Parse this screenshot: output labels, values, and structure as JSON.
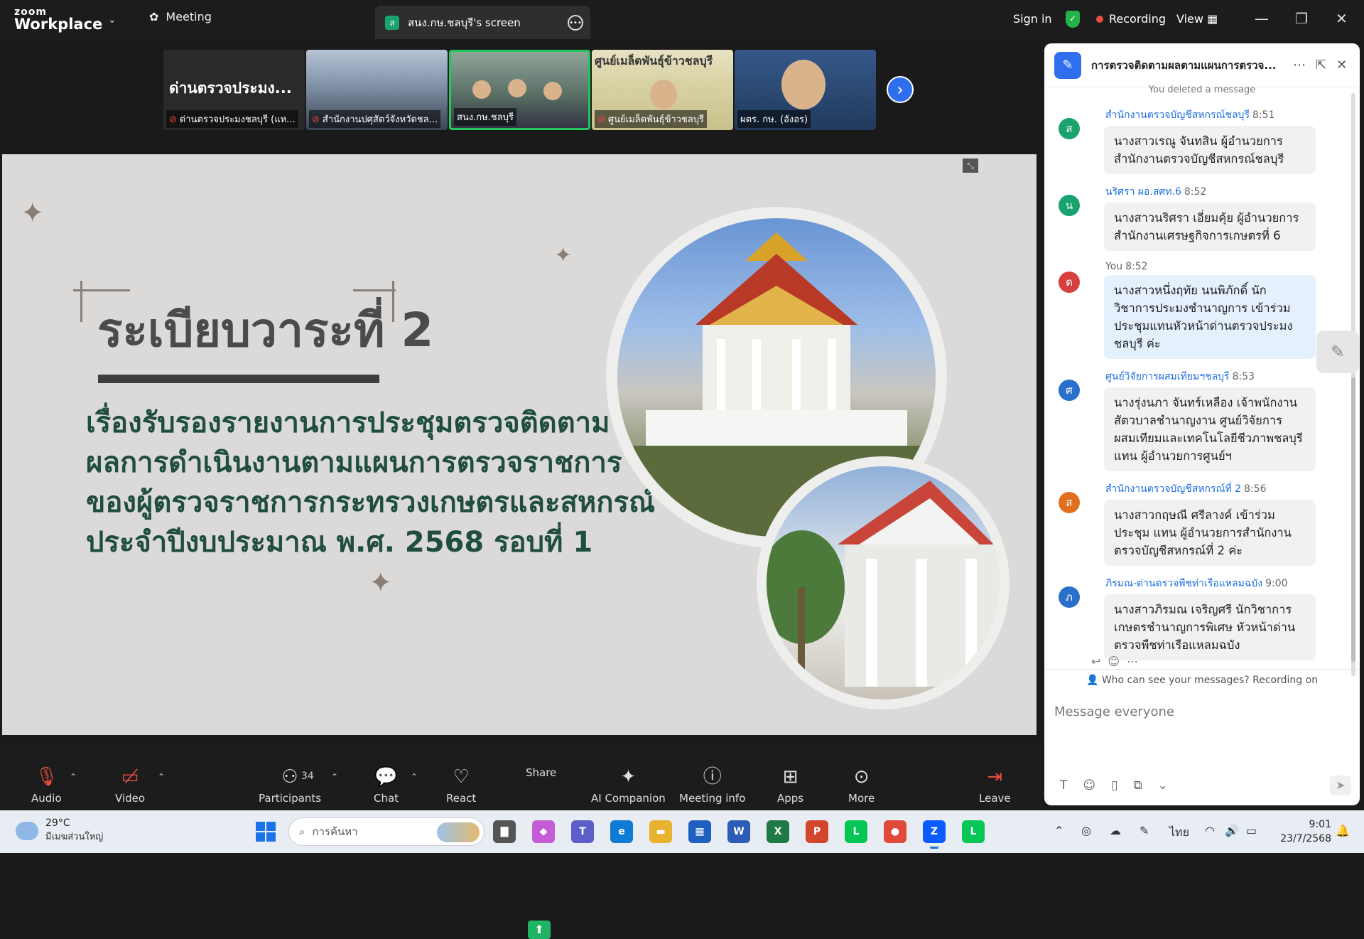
{
  "topbar": {
    "logo_top": "zoom",
    "logo_bottom": "Workplace",
    "meeting_tab": "Meeting",
    "screen_tab_badge": "ส",
    "screen_tab": "สนง.กษ.ชลบุรี's screen",
    "sign_in": "Sign in",
    "recording": "Recording",
    "view": "View"
  },
  "thumbnails": [
    {
      "big": "ด่านตรวจประมง...",
      "caption": "ด่านตรวจประมงชลบุรี (แห..."
    },
    {
      "caption": "สำนักงานปศุสัตว์จังหวัดชล..."
    },
    {
      "caption": "สนง.กษ.ชลบุรี"
    },
    {
      "header": "ศูนย์เมล็ดพันธุ์ข้าวชลบุรี",
      "caption": "ศูนย์เมล็ดพันธุ์ข้าวชลบุรี"
    },
    {
      "caption": "ผตร. กษ. (อังอร)"
    }
  ],
  "slide": {
    "title": "ระเบียบวาระที่ 2",
    "body": [
      "เรื่องรับรองรายงานการประชุมตรวจติดตาม",
      "ผลการดำเนินงานตามแผนการตรวจราชการ",
      "ของผู้ตรวจราชการกระทรวงเกษตรและสหกรณ์",
      "ประจำปีงบประมาณ พ.ศ. 2568 รอบที่ 1"
    ]
  },
  "chat": {
    "title": "การตรวจติดตามผลตามแผนการตรวจ...",
    "deleted_note": "You deleted a message",
    "messages": [
      {
        "avatar": "ส",
        "color": "#1aa36f",
        "sender": "สำนักงานตรวจบัญชีสหกรณ์ชลบุรี",
        "time": "8:51",
        "text": "นางสาวเรณู  จันทสิน ผู้อำนวยการสำนักงานตรวจบัญชีสหกรณ์ชลบุรี",
        "me": false
      },
      {
        "avatar": "น",
        "color": "#1aa36f",
        "sender": "นริศรา ผอ.สศท.6",
        "time": "8:52",
        "text": "นางสาวนริศรา เอี่ยมคุ้ย ผู้อำนวยการสำนักงานเศรษฐกิจการเกษตรที่ 6",
        "me": false
      },
      {
        "avatar": "ด",
        "color": "#d64040",
        "sender": "You",
        "time": "8:52",
        "text": "นางสาวหนึ่งฤทัย นนพิภักดิ์ นักวิชาการประมงชำนาญการ เข้าร่วมประชุมแทนหัวหน้าด่านตรวจประมงชลบุรี ค่ะ",
        "me": true
      },
      {
        "avatar": "ศ",
        "color": "#2a6fc9",
        "sender": "ศูนย์วิจัยการผสมเทียมฯชลบุรี",
        "time": "8:53",
        "text": "นางรุ่งนภา จันทร์เหลือง เจ้าพนักงานสัตวบาลชำนาญงาน ศูนย์วิจัยการผสมเทียมและเทคโนโลยีชีวภาพชลบุรี  แทน ผู้อำนวยการศูนย์ฯ",
        "me": false
      },
      {
        "avatar": "ส",
        "color": "#e0701e",
        "sender": "สำนักงานตรวจบัญชีสหกรณ์ที่ 2",
        "time": "8:56",
        "text": "นางสาวกฤษณี ศรีลางค์ เข้าร่วมประชุม แทน ผู้อำนวยการสำนักงานตรวจบัญชีสหกรณ์ที่ 2 ค่ะ",
        "me": false
      },
      {
        "avatar": "ภ",
        "color": "#2a6fc9",
        "sender": "ภิรมณ-ด่านตรวจพืชท่าเรือแหลมฉบัง",
        "time": "9:00",
        "text": "นางสาวภิรมณ เจริญศรี นักวิชาการเกษตรชำนาญการพิเศษ หัวหน้าด่านตรวจพืชท่าเรือแหลมฉบัง",
        "me": false
      }
    ],
    "who_can_see": "Who can see your messages? Recording on",
    "input_placeholder": "Message everyone"
  },
  "toolbar": {
    "audio": "Audio",
    "video": "Video",
    "participants": "Participants",
    "participants_count": "34",
    "chat": "Chat",
    "react": "React",
    "share": "Share",
    "ai_companion": "AI Companion",
    "meeting_info": "Meeting info",
    "apps": "Apps",
    "more": "More",
    "leave": "Leave"
  },
  "taskbar": {
    "temp": "29°C",
    "weather": "มีเมฆส่วนใหญ่",
    "search_placeholder": "การค้นหา",
    "lang": "ไทย",
    "time": "9:01",
    "date": "23/7/2568",
    "apps": [
      {
        "name": "file-explorer-app",
        "glyph": "▇",
        "bg": "#555"
      },
      {
        "name": "copilot-app",
        "glyph": "◆",
        "bg": "#c45cd6"
      },
      {
        "name": "teams-app",
        "glyph": "T",
        "bg": "#5b5fc7"
      },
      {
        "name": "edge-app",
        "glyph": "e",
        "bg": "#0f7bd4"
      },
      {
        "name": "folder-app",
        "glyph": "▬",
        "bg": "#e9b22e"
      },
      {
        "name": "store-app",
        "glyph": "▦",
        "bg": "#1f5fbf"
      },
      {
        "name": "word-app",
        "glyph": "W",
        "bg": "#2b5db8"
      },
      {
        "name": "excel-app",
        "glyph": "X",
        "bg": "#1d7a45"
      },
      {
        "name": "powerpoint-app",
        "glyph": "P",
        "bg": "#d2462b"
      },
      {
        "name": "line-app-1",
        "glyph": "L",
        "bg": "#06c755"
      },
      {
        "name": "chrome-app",
        "glyph": "●",
        "bg": "#e04a3a"
      },
      {
        "name": "zoom-app",
        "glyph": "Z",
        "bg": "#0b5cff"
      },
      {
        "name": "line-app-2",
        "glyph": "L",
        "bg": "#06c755"
      }
    ]
  }
}
